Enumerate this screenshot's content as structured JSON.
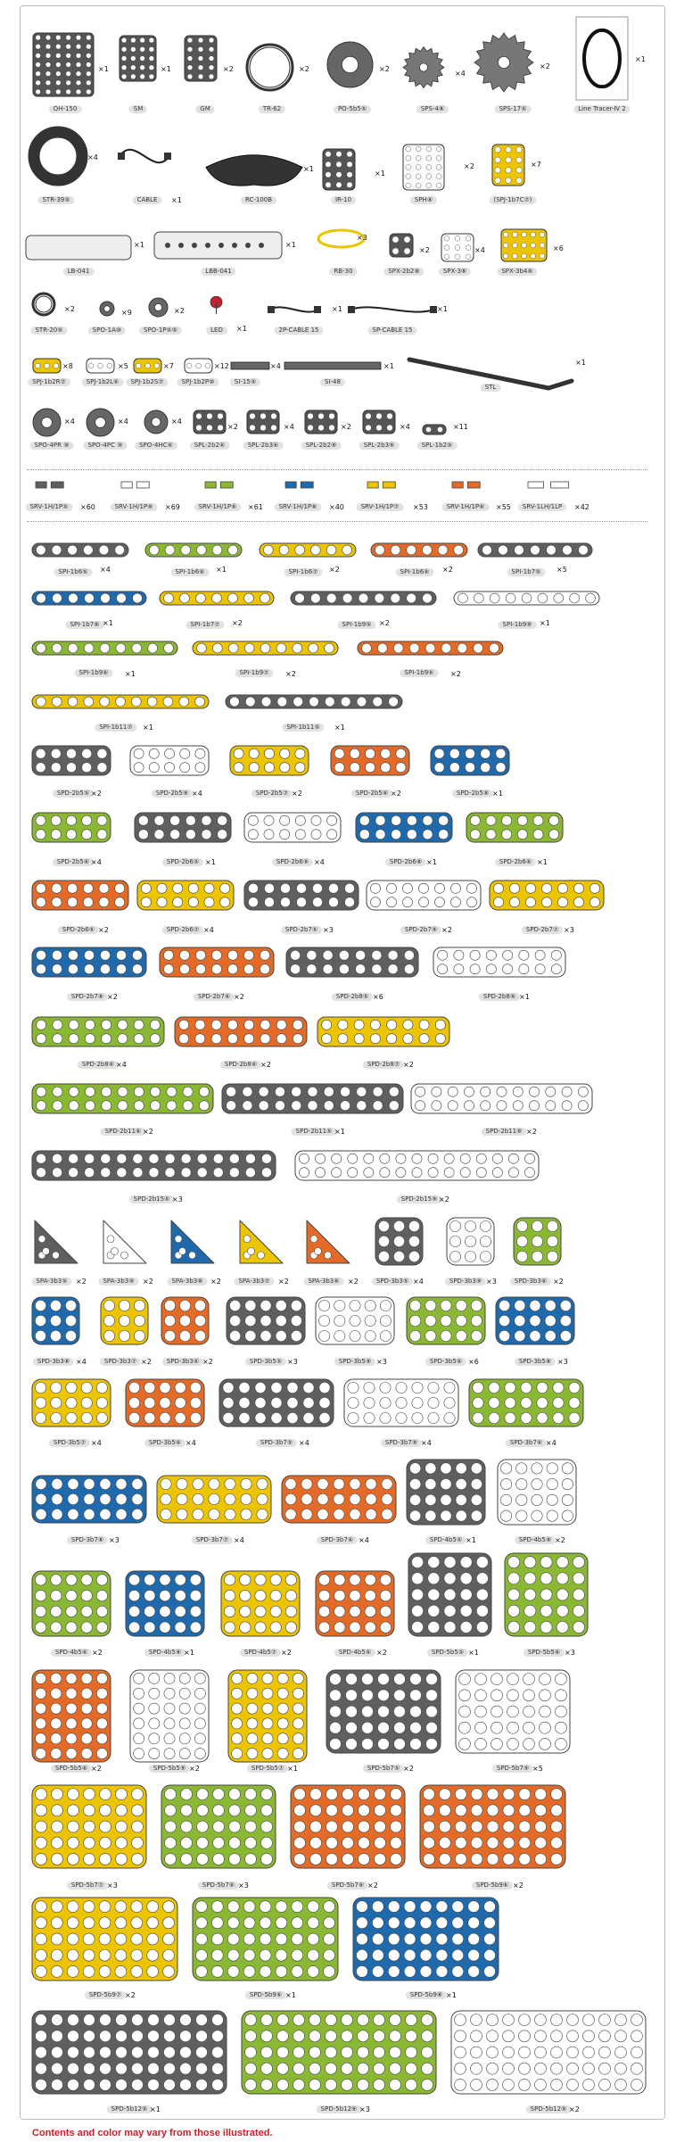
{
  "colors": {
    "gray": "#5f5f5f",
    "green": "#8ab833",
    "yellow": "#ecc400",
    "orange": "#e46a28",
    "blue": "#1f69ad",
    "white": "#ffffff",
    "dark": "#3a3a3a",
    "red": "#c8202c"
  },
  "footer_note": "Contents and color may vary from those illustrated.",
  "items": [
    {
      "code": "OH-150",
      "qty": "×1",
      "icon": "controller-icon"
    },
    {
      "code": "SM",
      "qty": "×1",
      "icon": "servo-motor-icon"
    },
    {
      "code": "GM",
      "qty": "×2",
      "icon": "gear-motor-icon"
    },
    {
      "code": "TR-62",
      "qty": "×2",
      "icon": "rubber-ring-icon"
    },
    {
      "code": "PO-5b5⑤",
      "qty": "×2",
      "icon": "pulley-icon"
    },
    {
      "code": "SPS-4⑧",
      "qty": "×4",
      "icon": "small-gear-icon"
    },
    {
      "code": "SPS-17⑤",
      "qty": "×2",
      "icon": "large-gear-icon"
    },
    {
      "code": "Line Tracer-Ⅳ 2",
      "qty": "×1",
      "icon": "line-tracer-sheet-icon"
    },
    {
      "code": "STR-39⑤",
      "qty": "×4",
      "icon": "tire-icon"
    },
    {
      "code": "CABLE",
      "qty": "×1",
      "icon": "usb-cable-icon"
    },
    {
      "code": "RC-100B",
      "qty": "×1",
      "icon": "remote-controller-icon"
    },
    {
      "code": "IR-10",
      "qty": "×1",
      "icon": "ir-sensor-icon"
    },
    {
      "code": "SPH⑧",
      "qty": "×2",
      "icon": "frame-icon"
    },
    {
      "code": "(SPJ-1b7C⑦)",
      "qty": "×7",
      "icon": "curved-joint-icon"
    },
    {
      "code": "LB-041",
      "qty": "×1",
      "icon": "battery-icon"
    },
    {
      "code": "LBB-041",
      "qty": "×1",
      "icon": "battery-box-icon"
    },
    {
      "code": "RB-30",
      "qty": "×3",
      "icon": "rubber-band-icon"
    },
    {
      "code": "SPX-2b2⑧",
      "qty": "×2",
      "icon": "connector-icon"
    },
    {
      "code": "SPX-3⑧",
      "qty": "×4",
      "icon": "connector-icon"
    },
    {
      "code": "SPX-3b4⑥",
      "qty": "×6",
      "icon": "connector-icon"
    },
    {
      "code": "STR-20⑤",
      "qty": "×2",
      "icon": "ring-icon"
    },
    {
      "code": "SPO-1A⑩",
      "qty": "×9",
      "icon": "bushing-icon"
    },
    {
      "code": "SPO-1P⑤⑤",
      "qty": "×2",
      "icon": "pulley-small-icon"
    },
    {
      "code": "LED",
      "qty": "×1",
      "icon": "led-icon"
    },
    {
      "code": "2P-CABLE 15",
      "qty": "×1",
      "icon": "cable-icon"
    },
    {
      "code": "SP-CABLE 15",
      "qty": "×1",
      "icon": "cable-icon"
    },
    {
      "code": "SPJ-1b2R⑦",
      "qty": "×8",
      "icon": "joint-icon"
    },
    {
      "code": "SPJ-1b2L⑥",
      "qty": "×5",
      "icon": "joint-icon"
    },
    {
      "code": "SPJ-1b2S⑦",
      "qty": "×7",
      "icon": "joint-icon"
    },
    {
      "code": "SPJ-1b2P⑩",
      "qty": "×12",
      "icon": "joint-icon"
    },
    {
      "code": "SI-15⑤",
      "qty": "×4",
      "icon": "shaft-icon"
    },
    {
      "code": "SI-48",
      "qty": "×1",
      "icon": "shaft-icon"
    },
    {
      "code": "STL",
      "qty": "×1",
      "icon": "long-rod-icon"
    },
    {
      "code": "SPO-4PR ⑨",
      "qty": "×4",
      "icon": "wheel-hub-icon"
    },
    {
      "code": "SPO-4PC ⑨",
      "qty": "×4",
      "icon": "wheel-hub-icon"
    },
    {
      "code": "SPO-4HC⑥",
      "qty": "×4",
      "icon": "hub-icon"
    },
    {
      "code": "SPL-2b2⑥",
      "qty": "×2",
      "icon": "l-bracket-icon"
    },
    {
      "code": "SPL-2b3⑥",
      "qty": "×4",
      "icon": "l-bracket-icon"
    },
    {
      "code": "SPL-2b2⑨",
      "qty": "×2",
      "icon": "l-bracket-icon"
    },
    {
      "code": "SPL-2b3⑨",
      "qty": "×4",
      "icon": "l-bracket-icon"
    },
    {
      "code": "SPL-1b2⑤",
      "qty": "×11",
      "icon": "l-bracket-icon"
    },
    {
      "code": "SRV-1H/1P⑤",
      "qty": "×60",
      "icon": "rivet-icon"
    },
    {
      "code": "SRV-1H/1P⑨",
      "qty": "×69",
      "icon": "rivet-icon"
    },
    {
      "code": "SRV-1H/1P⑥",
      "qty": "×61",
      "icon": "rivet-icon"
    },
    {
      "code": "SRV-1H/1P⑧",
      "qty": "×40",
      "icon": "rivet-icon"
    },
    {
      "code": "SRV-1H/1P⑦",
      "qty": "×53",
      "icon": "rivet-icon"
    },
    {
      "code": "SRV-1H/1P⑥",
      "qty": "×55",
      "icon": "rivet-icon"
    },
    {
      "code": "SRV-1LH/1LP",
      "qty": "×42",
      "icon": "rivet-icon"
    },
    {
      "code": "SPI-1b6⑤",
      "qty": "×4",
      "icon": "beam-icon"
    },
    {
      "code": "SPI-1b6⑥",
      "qty": "×1",
      "icon": "beam-icon"
    },
    {
      "code": "SPI-1b6⑦",
      "qty": "×2",
      "icon": "beam-icon"
    },
    {
      "code": "SPI-1b6⑥",
      "qty": "×2",
      "icon": "beam-icon"
    },
    {
      "code": "SPI-1b7⑤",
      "qty": "×5",
      "icon": "beam-icon"
    },
    {
      "code": "SPI-1b7⑧",
      "qty": "×1",
      "icon": "beam-icon"
    },
    {
      "code": "SPI-1b7⑦",
      "qty": "×2",
      "icon": "beam-icon"
    },
    {
      "code": "SPI-1b9⑤",
      "qty": "×2",
      "icon": "beam-icon"
    },
    {
      "code": "SPI-1b9⑨",
      "qty": "×1",
      "icon": "beam-icon"
    },
    {
      "code": "SPI-1b9⑥",
      "qty": "×1",
      "icon": "beam-icon"
    },
    {
      "code": "SPI-1b9⑦",
      "qty": "×2",
      "icon": "beam-icon"
    },
    {
      "code": "SPI-1b9⑥",
      "qty": "×2",
      "icon": "beam-icon"
    },
    {
      "code": "SPI-1b11⑦",
      "qty": "×1",
      "icon": "beam-icon"
    },
    {
      "code": "SPI-1b11⑤",
      "qty": "×1",
      "icon": "beam-icon"
    },
    {
      "code": "SPD-2b5⑤",
      "qty": "×2",
      "icon": "plate-icon"
    },
    {
      "code": "SPD-2b5⑨",
      "qty": "×4",
      "icon": "plate-icon"
    },
    {
      "code": "SPD-2b5⑦",
      "qty": "×2",
      "icon": "plate-icon"
    },
    {
      "code": "SPD-2b5⑥",
      "qty": "×2",
      "icon": "plate-icon"
    },
    {
      "code": "SPD-2b5⑧",
      "qty": "×1",
      "icon": "plate-icon"
    },
    {
      "code": "SPD-2b5⑥",
      "qty": "×4",
      "icon": "plate-icon"
    },
    {
      "code": "SPD-2b6⑤",
      "qty": "×1",
      "icon": "plate-icon"
    },
    {
      "code": "SPD-2b6⑨",
      "qty": "×4",
      "icon": "plate-icon"
    },
    {
      "code": "SPD-2b6⑧",
      "qty": "×1",
      "icon": "plate-icon"
    },
    {
      "code": "SPD-2b6⑥",
      "qty": "×1",
      "icon": "plate-icon"
    },
    {
      "code": "SPD-2b6⑥",
      "qty": "×2",
      "icon": "plate-icon"
    },
    {
      "code": "SPD-2b6⑦",
      "qty": "×4",
      "icon": "plate-icon"
    },
    {
      "code": "SPD-2b7⑤",
      "qty": "×3",
      "icon": "plate-icon"
    },
    {
      "code": "SPD-2b7⑨",
      "qty": "×2",
      "icon": "plate-icon"
    },
    {
      "code": "SPD-2b7⑦",
      "qty": "×3",
      "icon": "plate-icon"
    },
    {
      "code": "SPD-2b7⑧",
      "qty": "×2",
      "icon": "plate-icon"
    },
    {
      "code": "SPD-2b7⑥",
      "qty": "×2",
      "icon": "plate-icon"
    },
    {
      "code": "SPD-2b8⑤",
      "qty": "×6",
      "icon": "plate-icon"
    },
    {
      "code": "SPD-2b8⑨",
      "qty": "×1",
      "icon": "plate-icon"
    },
    {
      "code": "SPD-2b8⑥",
      "qty": "×4",
      "icon": "plate-icon"
    },
    {
      "code": "SPD-2b8⑥",
      "qty": "×2",
      "icon": "plate-icon"
    },
    {
      "code": "SPD-2b8⑦",
      "qty": "×2",
      "icon": "plate-icon"
    },
    {
      "code": "SPD-2b11⑥",
      "qty": "×2",
      "icon": "plate-icon"
    },
    {
      "code": "SPD-2b11⑤",
      "qty": "×1",
      "icon": "plate-icon"
    },
    {
      "code": "SPD-2b11⑨",
      "qty": "×2",
      "icon": "plate-icon"
    },
    {
      "code": "SPD-2b15⑤",
      "qty": "×3",
      "icon": "plate-icon"
    },
    {
      "code": "SPD-2b15⑨",
      "qty": "×2",
      "icon": "plate-icon"
    },
    {
      "code": "SPA-3b3⑤",
      "qty": "×2",
      "icon": "triangle-plate-icon"
    },
    {
      "code": "SPA-3b3⑨",
      "qty": "×2",
      "icon": "triangle-plate-icon"
    },
    {
      "code": "SPA-3b3⑧",
      "qty": "×2",
      "icon": "triangle-plate-icon"
    },
    {
      "code": "SPA-3b3⑦",
      "qty": "×2",
      "icon": "triangle-plate-icon"
    },
    {
      "code": "SPA-3b3⑥",
      "qty": "×2",
      "icon": "triangle-plate-icon"
    },
    {
      "code": "SPD-3b3⑤",
      "qty": "×4",
      "icon": "plate-icon"
    },
    {
      "code": "SPD-3b3⑨",
      "qty": "×3",
      "icon": "plate-icon"
    },
    {
      "code": "SPD-3b3⑥",
      "qty": "×2",
      "icon": "plate-icon"
    },
    {
      "code": "SPD-3b3⑧",
      "qty": "×4",
      "icon": "plate-icon"
    },
    {
      "code": "SPD-3b3⑦",
      "qty": "×2",
      "icon": "plate-icon"
    },
    {
      "code": "SPD-3b3⑥",
      "qty": "×2",
      "icon": "plate-icon"
    },
    {
      "code": "SPD-3b5⑤",
      "qty": "×3",
      "icon": "plate-icon"
    },
    {
      "code": "SPD-3b5⑨",
      "qty": "×3",
      "icon": "plate-icon"
    },
    {
      "code": "SPD-3b5⑥",
      "qty": "×6",
      "icon": "plate-icon"
    },
    {
      "code": "SPD-3b5⑧",
      "qty": "×3",
      "icon": "plate-icon"
    },
    {
      "code": "SPD-3b5⑦",
      "qty": "×4",
      "icon": "plate-icon"
    },
    {
      "code": "SPD-3b5⑥",
      "qty": "×4",
      "icon": "plate-icon"
    },
    {
      "code": "SPD-3b7⑤",
      "qty": "×4",
      "icon": "plate-icon"
    },
    {
      "code": "SPD-3b7⑨",
      "qty": "×4",
      "icon": "plate-icon"
    },
    {
      "code": "SPD-3b7⑥",
      "qty": "×4",
      "icon": "plate-icon"
    },
    {
      "code": "SPD-3b7⑧",
      "qty": "×3",
      "icon": "plate-icon"
    },
    {
      "code": "SPD-3b7⑦",
      "qty": "×4",
      "icon": "plate-icon"
    },
    {
      "code": "SPD-3b7⑥",
      "qty": "×4",
      "icon": "plate-icon"
    },
    {
      "code": "SPD-4b5⑤",
      "qty": "×1",
      "icon": "plate-icon"
    },
    {
      "code": "SPD-4b5⑨",
      "qty": "×2",
      "icon": "plate-icon"
    },
    {
      "code": "SPD-4b5⑥",
      "qty": "×2",
      "icon": "plate-icon"
    },
    {
      "code": "SPD-4b5⑧",
      "qty": "×1",
      "icon": "plate-icon"
    },
    {
      "code": "SPD-4b5⑦",
      "qty": "×2",
      "icon": "plate-icon"
    },
    {
      "code": "SPD-4b5⑥",
      "qty": "×2",
      "icon": "plate-icon"
    },
    {
      "code": "SPD-5b5⑤",
      "qty": "×1",
      "icon": "plate-icon"
    },
    {
      "code": "SPD-5b5⑥",
      "qty": "×3",
      "icon": "plate-icon"
    },
    {
      "code": "SPD-5b5⑥",
      "qty": "×2",
      "icon": "plate-icon"
    },
    {
      "code": "SPD-5b5⑨",
      "qty": "×2",
      "icon": "plate-icon"
    },
    {
      "code": "SPD-5b5⑦",
      "qty": "×1",
      "icon": "plate-icon"
    },
    {
      "code": "SPD-5b7⑤",
      "qty": "×2",
      "icon": "plate-icon"
    },
    {
      "code": "SPD-5b7⑨",
      "qty": "×5",
      "icon": "plate-icon"
    },
    {
      "code": "SPD-5b7⑦",
      "qty": "×3",
      "icon": "plate-icon"
    },
    {
      "code": "SPD-5b7⑥",
      "qty": "×3",
      "icon": "plate-icon"
    },
    {
      "code": "SPD-5b7⑥",
      "qty": "×2",
      "icon": "plate-icon"
    },
    {
      "code": "SPD-5b9⑥",
      "qty": "×2",
      "icon": "plate-icon"
    },
    {
      "code": "SPD-5b9⑦",
      "qty": "×2",
      "icon": "plate-icon"
    },
    {
      "code": "SPD-5b9⑥",
      "qty": "×1",
      "icon": "plate-icon"
    },
    {
      "code": "SPD-5b9⑧",
      "qty": "×1",
      "icon": "plate-icon"
    },
    {
      "code": "SPD-5b12⑤",
      "qty": "×1",
      "icon": "plate-icon"
    },
    {
      "code": "SPD-5b12⑥",
      "qty": "×3",
      "icon": "plate-icon"
    },
    {
      "code": "SPD-5b12⑨",
      "qty": "×2",
      "icon": "plate-icon"
    }
  ]
}
